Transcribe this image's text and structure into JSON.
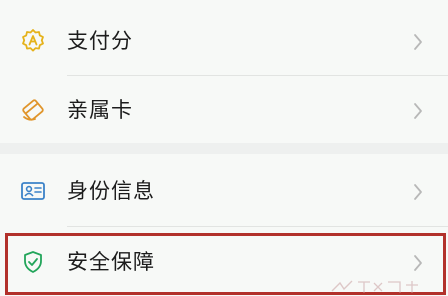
{
  "menu": {
    "group1": [
      {
        "label": "支付分",
        "icon": "payment-score-icon",
        "color": "#e5b21a"
      },
      {
        "label": "亲属卡",
        "icon": "family-card-icon",
        "color": "#e0952b"
      }
    ],
    "group2": [
      {
        "label": "身份信息",
        "icon": "id-card-icon",
        "color": "#3b82c8"
      },
      {
        "label": "安全保障",
        "icon": "shield-icon",
        "color": "#22a55a"
      }
    ]
  },
  "colors": {
    "highlight_border": "#b2312b",
    "chevron": "#b8b8b8"
  }
}
